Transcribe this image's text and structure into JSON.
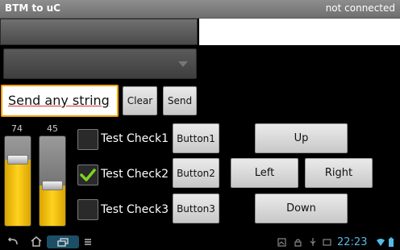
{
  "title_bar": {
    "app_title": "BTM to uC",
    "status": "not connected"
  },
  "spinner": {
    "selected": ""
  },
  "send": {
    "input_value": "Send any string",
    "clear_label": "Clear",
    "send_label": "Send"
  },
  "sliders": [
    {
      "value_label": "74",
      "level": 0.74
    },
    {
      "value_label": "45",
      "level": 0.45
    }
  ],
  "checkboxes": [
    {
      "label": "Test Check1",
      "checked": false
    },
    {
      "label": "Test Check2",
      "checked": true
    },
    {
      "label": "Test Check3",
      "checked": false
    }
  ],
  "buttons": {
    "button1": "Button1",
    "button2": "Button2",
    "button3": "Button3"
  },
  "dpad": {
    "up": "Up",
    "left": "Left",
    "right": "Right",
    "down": "Down"
  },
  "system_bar": {
    "clock": "22:23"
  },
  "colors": {
    "accent": "#f0a000",
    "slider_fill": "#ffd21f",
    "check_mark": "#7ed321",
    "clock": "#56b9e6"
  }
}
